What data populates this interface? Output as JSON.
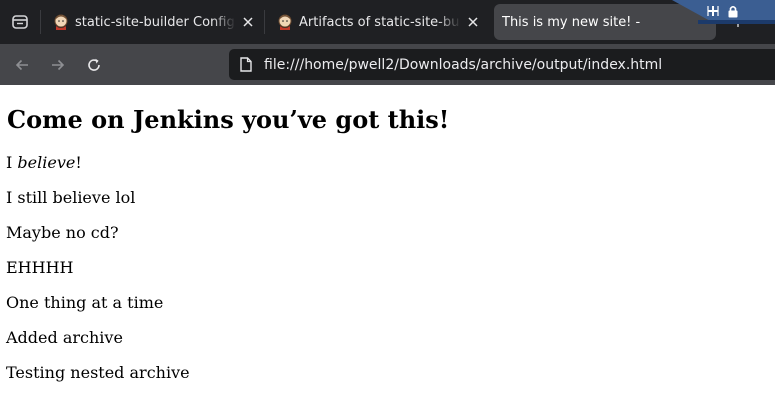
{
  "tabs": [
    {
      "title": "static-site-builder Config [J",
      "active": false,
      "favicon": "jenkins-icon"
    },
    {
      "title": "Artifacts of static-site-build",
      "active": false,
      "favicon": "jenkins-icon"
    },
    {
      "title": "This is my new site! -",
      "active": true,
      "favicon": ""
    }
  ],
  "address_bar": {
    "url": "file:///home/pwell2/Downloads/archive/output/index.html"
  },
  "icons": {
    "tab_list": "tab-list-icon",
    "close": "close-icon",
    "new_tab": "plus-icon",
    "back": "back-arrow-icon",
    "forward": "forward-arrow-icon",
    "reload": "reload-icon",
    "page": "file-icon",
    "system_plus": "plus-icon",
    "system_lock": "lock-icon"
  },
  "page": {
    "heading": "Come on Jenkins you’ve got this!",
    "line1_prefix": "I ",
    "line1_em": "believe",
    "line1_suffix": "!",
    "paragraphs": [
      "I still believe lol",
      "Maybe no cd?",
      "EHHHH",
      "One thing at a time",
      "Added archive",
      "Testing nested archive"
    ]
  },
  "colors": {
    "tabstrip_bg": "#1f2023",
    "active_tab_bg": "#45464a",
    "toolbar_bg": "#45464a",
    "urlbar_bg": "#1b1c1e",
    "content_bg": "#ffffff"
  }
}
